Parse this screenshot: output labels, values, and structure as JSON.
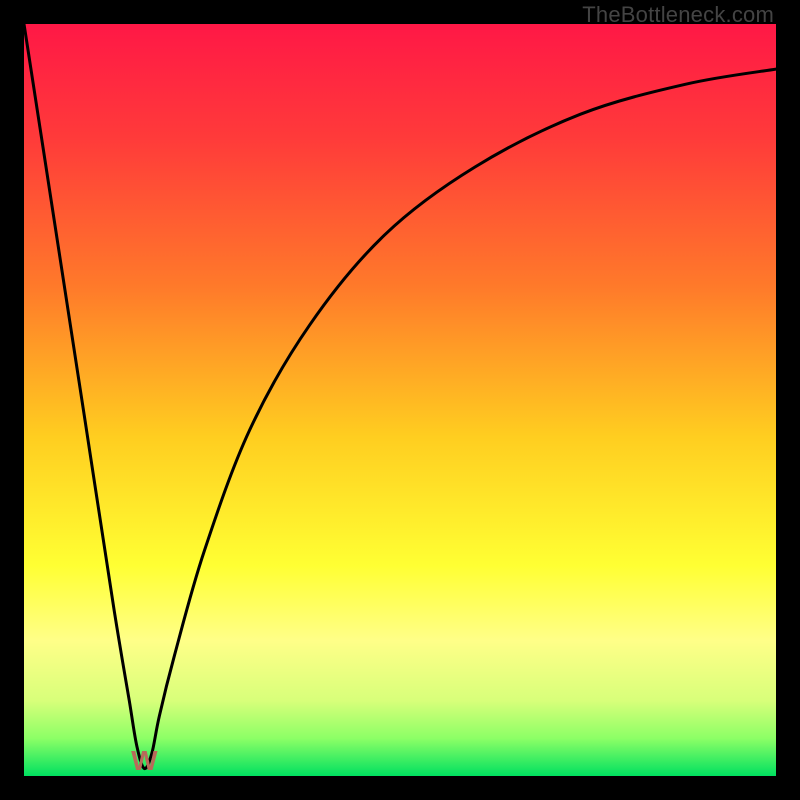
{
  "watermark": "TheBottleneck.com",
  "chart_data": {
    "type": "line",
    "title": "",
    "xlabel": "",
    "ylabel": "",
    "xlim": [
      0,
      100
    ],
    "ylim": [
      0,
      100
    ],
    "grid": false,
    "legend": false,
    "background_gradient": {
      "stops": [
        {
          "pos": 0.0,
          "color": "#ff1846"
        },
        {
          "pos": 0.15,
          "color": "#ff3a3a"
        },
        {
          "pos": 0.35,
          "color": "#ff7a2a"
        },
        {
          "pos": 0.55,
          "color": "#ffce20"
        },
        {
          "pos": 0.72,
          "color": "#ffff33"
        },
        {
          "pos": 0.82,
          "color": "#ffff88"
        },
        {
          "pos": 0.9,
          "color": "#d8ff7a"
        },
        {
          "pos": 0.95,
          "color": "#8cff66"
        },
        {
          "pos": 1.0,
          "color": "#00e060"
        }
      ]
    },
    "curve": {
      "note": "V-shaped bottleneck curve; y is bottleneck % (0 at minimum). Minimum near x≈16.",
      "x": [
        0,
        4,
        8,
        12,
        14,
        15,
        16,
        17,
        18,
        20,
        24,
        30,
        38,
        48,
        60,
        74,
        88,
        100
      ],
      "y": [
        100,
        74,
        48,
        22,
        10,
        4,
        1,
        3,
        8,
        16,
        30,
        46,
        60,
        72,
        81,
        88,
        92,
        94
      ]
    },
    "minimum_marker": {
      "x": 16,
      "y": 1,
      "glyph": "W",
      "color": "#b86a5a"
    }
  }
}
